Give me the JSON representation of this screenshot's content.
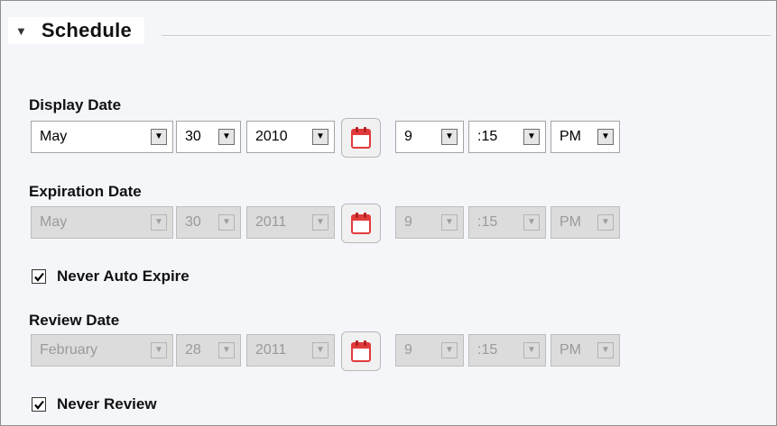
{
  "section": {
    "title": "Schedule",
    "toggle_glyph": "▼"
  },
  "dropdown_arrow": "▼",
  "display_date": {
    "label": "Display Date",
    "month": "May",
    "day": "30",
    "year": "2010",
    "hour": "9",
    "minute": ":15",
    "ampm": "PM"
  },
  "expiration_date": {
    "label": "Expiration Date",
    "month": "May",
    "day": "30",
    "year": "2011",
    "hour": "9",
    "minute": ":15",
    "ampm": "PM"
  },
  "never_auto_expire": {
    "label": "Never Auto Expire",
    "checked": true
  },
  "review_date": {
    "label": "Review Date",
    "month": "February",
    "day": "28",
    "year": "2011",
    "hour": "9",
    "minute": ":15",
    "ampm": "PM"
  },
  "never_review": {
    "label": "Never Review",
    "checked": true
  },
  "icons": {
    "calendar": "calendar-icon",
    "check": "checkmark-icon",
    "collapse": "triangle-down-icon"
  },
  "colors": {
    "calendar_red": "#e23b3b",
    "disabled_bg": "#dcdcdc",
    "panel_bg": "#f4f6f9"
  }
}
